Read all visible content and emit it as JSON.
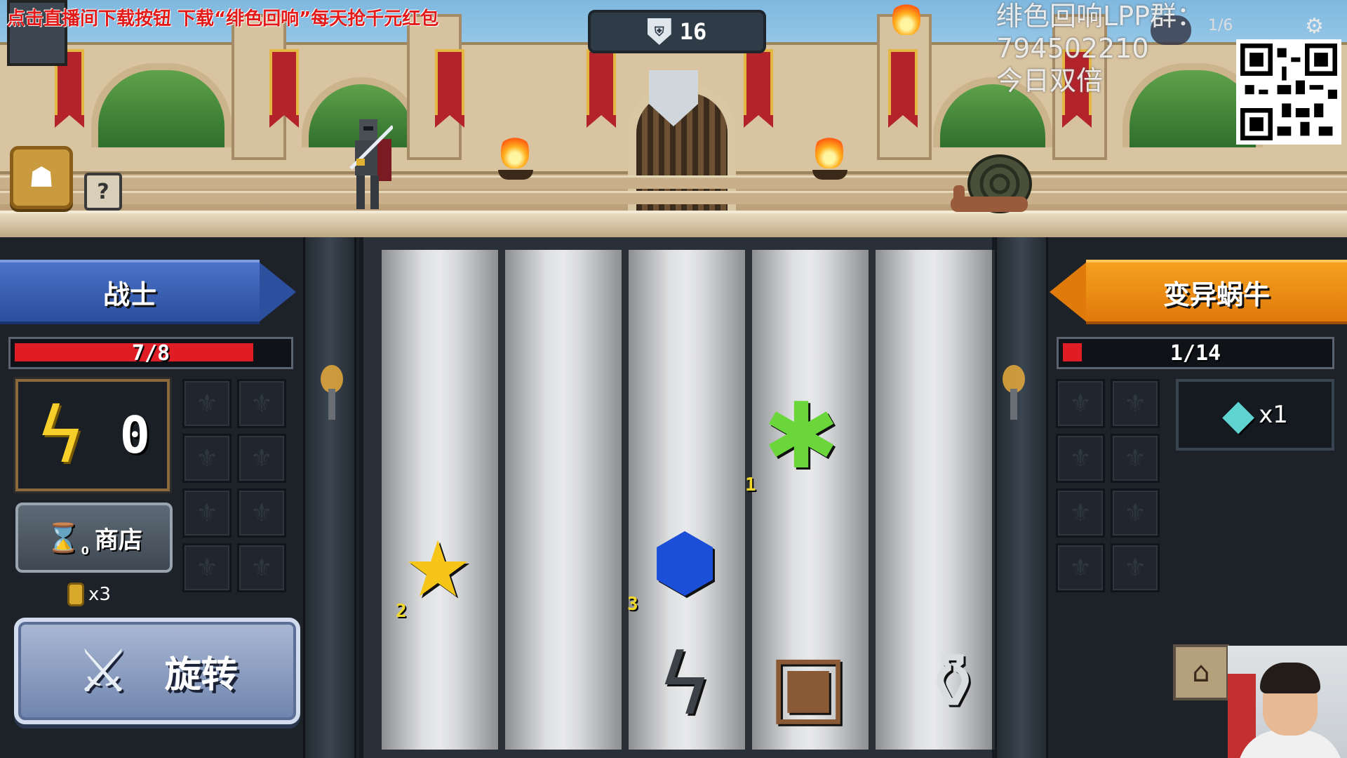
{
  "top": {
    "promo_text": "点击直播间下载按钮 下载“绯色回响”每天抢千元红包",
    "group_line1": "绯色回响LPP群：794502210",
    "group_line2": "今日双倍",
    "wave_number": "16",
    "shield_glyph": "⛨",
    "small_counter": "1/6",
    "gear_glyph": "⚙",
    "bag_glyph": "☗",
    "help_glyph": "?"
  },
  "player": {
    "name": "战士",
    "hp_text": "7/8",
    "hp_current": 7,
    "hp_max": 8,
    "energy_value": "0",
    "energy_glyph": "ϟ",
    "shop_label": "商店",
    "hourglass_glyph": "⌛",
    "hourglass_sub": "0",
    "coin_count": "x3",
    "spin_label": "旋转",
    "spin_glyph": "⚔",
    "slot_glyph": "⚜"
  },
  "enemy": {
    "name": "变异蜗牛",
    "hp_text": "1/14",
    "hp_current": 1,
    "hp_max": 14,
    "item_glyph": "◆",
    "item_count": "x1",
    "castle_glyph": "⌂"
  },
  "reels": [
    {
      "items": [
        {
          "name": "star",
          "glyph": "★",
          "color": "#f5c518",
          "count": "2"
        }
      ]
    },
    {
      "items": []
    },
    {
      "items": [
        {
          "name": "sapphire",
          "glyph": "⬢",
          "color": "#1c4fd8",
          "count": "3"
        },
        {
          "name": "lightning-dark",
          "glyph": "ϟ",
          "color": "#3d4249",
          "count": ""
        }
      ]
    },
    {
      "items": [
        {
          "name": "slime-splat",
          "glyph": "✱",
          "color": "#6ad63a",
          "count": "1"
        },
        {
          "name": "wooden-shield",
          "glyph": "▣",
          "color": "#8a5a36",
          "count": ""
        }
      ]
    },
    {
      "items": [
        {
          "name": "potion-vial",
          "glyph": "⚱",
          "color": "#d9dde0",
          "count": ""
        }
      ]
    }
  ],
  "colors": {
    "player_banner": "#2c4f9e",
    "enemy_banner": "#e07a0a",
    "hp_red": "#e01c24"
  }
}
